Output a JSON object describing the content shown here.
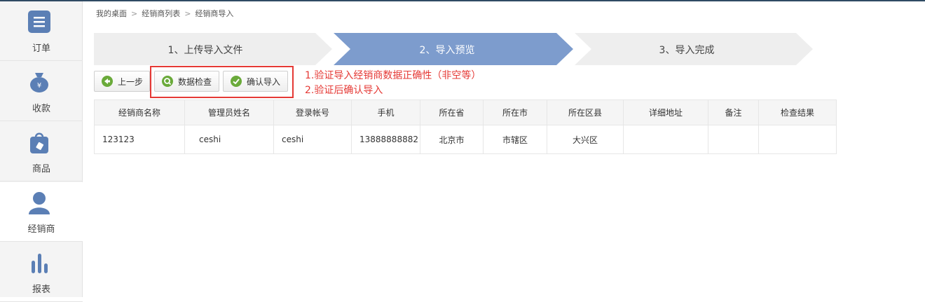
{
  "sidebar": {
    "items": [
      {
        "label": "订单",
        "icon": "list-icon",
        "active": false
      },
      {
        "label": "收款",
        "icon": "money-bag-icon",
        "active": false
      },
      {
        "label": "商品",
        "icon": "shopping-bag-icon",
        "active": false
      },
      {
        "label": "经销商",
        "icon": "user-icon",
        "active": true
      },
      {
        "label": "报表",
        "icon": "bar-chart-icon",
        "active": false
      }
    ]
  },
  "breadcrumb": [
    "我的桌面",
    "经销商列表",
    "经销商导入"
  ],
  "breadcrumb_separator": ">",
  "steps": [
    {
      "label": "1、上传导入文件",
      "active": false
    },
    {
      "label": "2、导入预览",
      "active": true
    },
    {
      "label": "3、导入完成",
      "active": false
    }
  ],
  "toolbar": {
    "prev_label": "上一步",
    "check_label": "数据检查",
    "confirm_label": "确认导入"
  },
  "annotation": {
    "line1": "1.验证导入经销商数据正确性（非空等）",
    "line2": "2.验证后确认导入"
  },
  "table": {
    "columns": [
      "经销商名称",
      "管理员姓名",
      "登录帐号",
      "手机",
      "所在省",
      "所在市",
      "所在区县",
      "详细地址",
      "备注",
      "检查结果"
    ],
    "rows": [
      [
        "123123",
        "ceshi",
        "ceshi",
        "13888888882",
        "北京市",
        "市辖区",
        "大兴区",
        "",
        "",
        ""
      ]
    ]
  },
  "colors": {
    "sidebar_icon": "#5b7fb5",
    "step_active": "#7d9ccd",
    "step_inactive": "#eeeeee",
    "annotation_red": "#e53935",
    "prev_icon": "#6aaa3a",
    "check_icon": "#6aaa3a",
    "confirm_icon": "#6aaa3a"
  }
}
